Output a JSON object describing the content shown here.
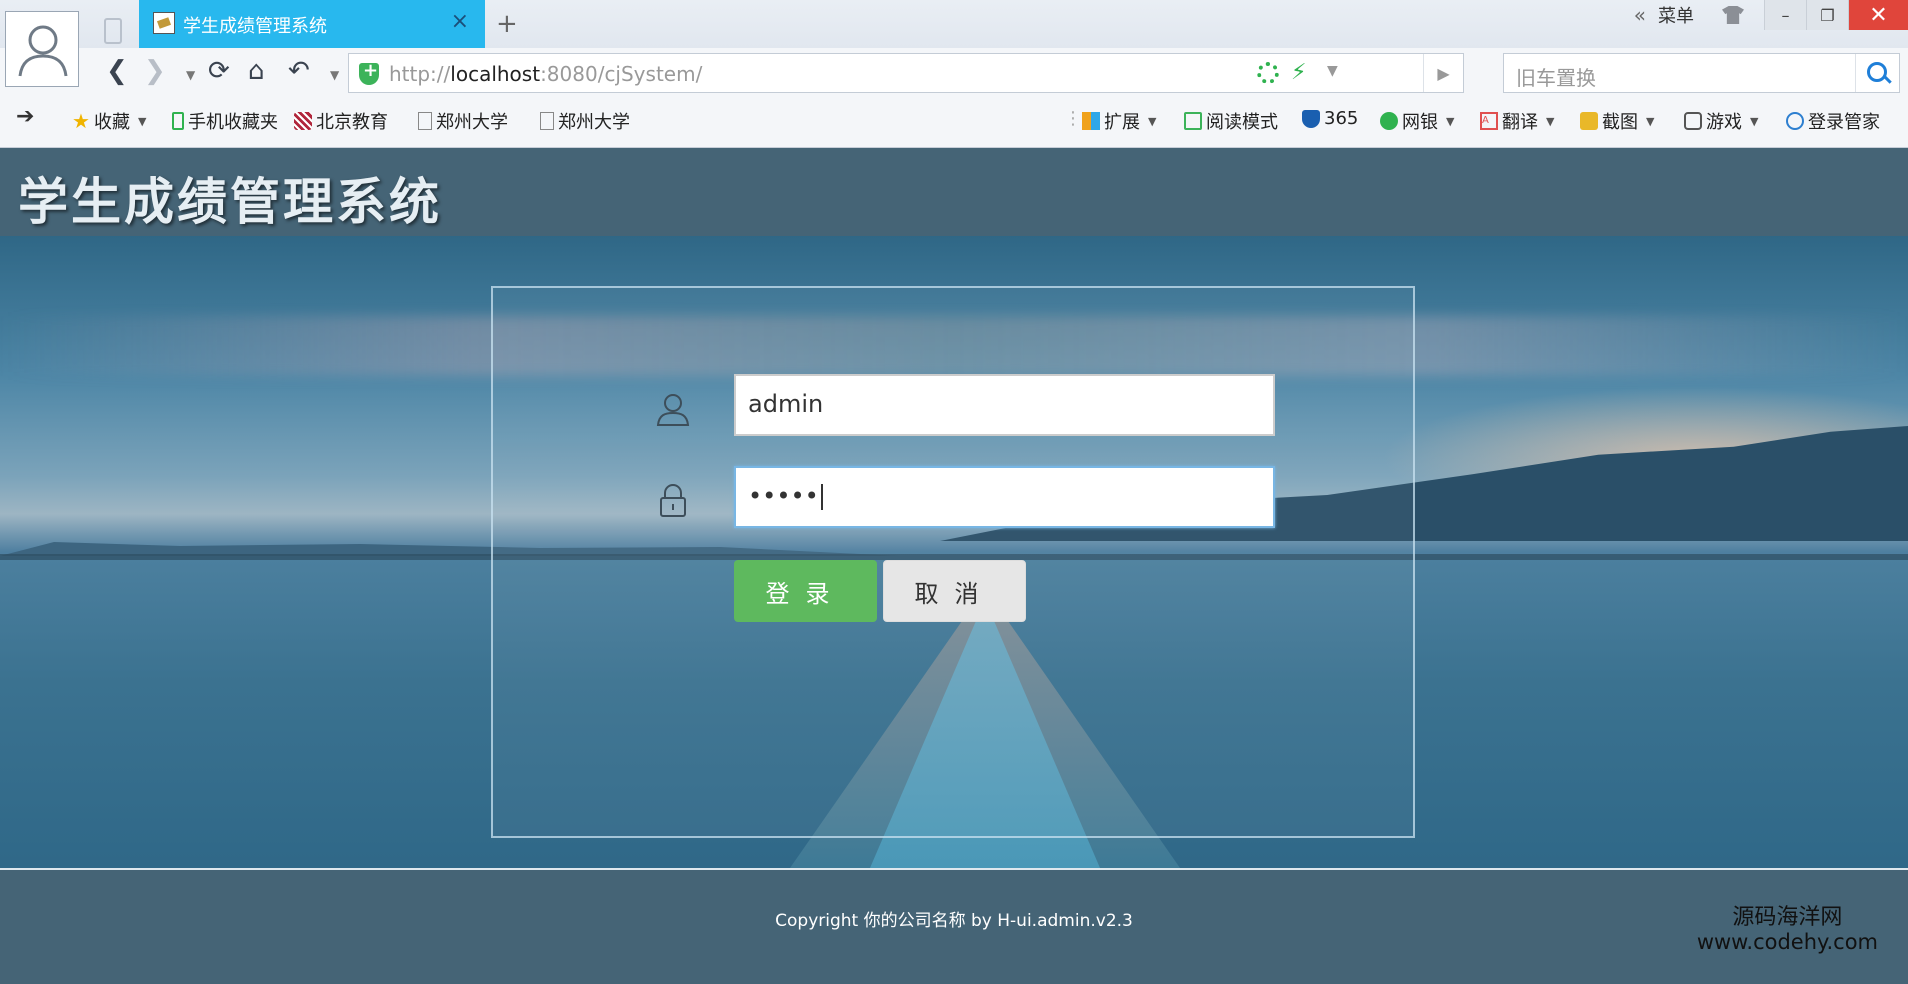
{
  "browser": {
    "tab_title": "学生成绩管理系统",
    "tab_close": "×",
    "new_tab": "+",
    "menu_label": "菜单",
    "collapse": "«",
    "min": "–",
    "restore": "❐",
    "close": "✕",
    "url_prefix": "http://",
    "url_host": "localhost",
    "url_rest": ":8080/cjSystem/",
    "search_placeholder": "旧车置换",
    "bookmarks": {
      "collect": "收藏",
      "mobile": "手机收藏夹",
      "bj_edu": "北京教育",
      "zzu1": "郑州大学",
      "zzu2": "郑州大学"
    },
    "toolbar": {
      "ext": "扩展",
      "read": "阅读模式",
      "n365": "365",
      "bank": "网银",
      "translate": "翻译",
      "screenshot": "截图",
      "games": "游戏",
      "manager": "登录管家"
    }
  },
  "page": {
    "title": "学生成绩管理系统",
    "username_value": "admin",
    "password_mask": "•••••",
    "login_label": "登录",
    "cancel_label": "取消",
    "copyright": "Copyright 你的公司名称 by H-ui.admin.v2.3"
  },
  "watermark": {
    "line1": "源码海洋网",
    "line2": "www.codehy.com"
  },
  "colors": {
    "header_bg": "#456476",
    "tab_active": "#28b8ee",
    "login_btn": "#5eb95e",
    "close_btn": "#e0453b"
  }
}
